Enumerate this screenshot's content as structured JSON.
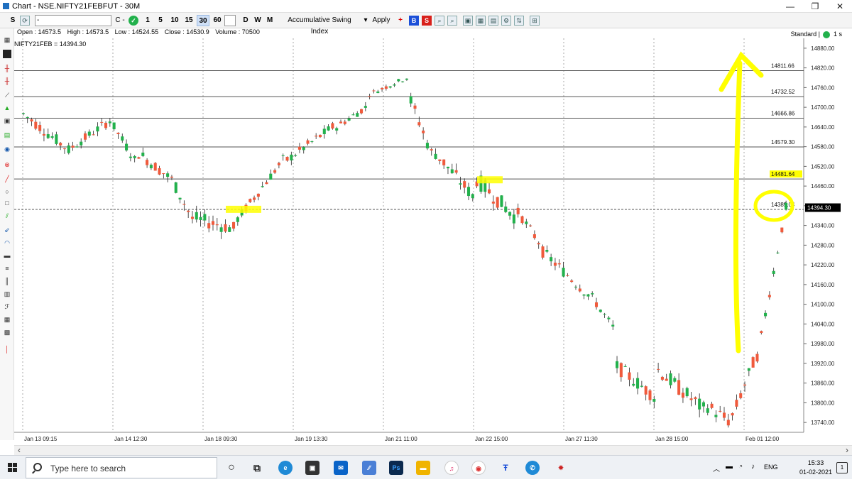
{
  "window": {
    "title": "Chart - NSE.NIFTY21FEBFUT - 30M",
    "minimize": "—",
    "maximize": "❐",
    "close": "✕"
  },
  "toolbar": {
    "s_label": "S",
    "symbol_input": "-",
    "chart_type": "C -",
    "intervals": [
      "1",
      "5",
      "10",
      "15",
      "30",
      "60"
    ],
    "selected_interval": "30",
    "periods": [
      "D",
      "W",
      "M"
    ],
    "indicator": "Accumulative Swing Index",
    "indicator_arrow": "▾",
    "apply_label": "Apply",
    "plus_label": "+",
    "buy_label": "B",
    "sell_label": "S"
  },
  "ohlc": {
    "open": "Open : 14573.5",
    "high": "High : 14573.5",
    "low": "Low : 14524.55",
    "close": "Close : 14530.9",
    "volume": "Volume : 70500"
  },
  "symbol_label": "NIFTY21FEB = 14394.30",
  "standard_label": "Standard |",
  "timeframe_label": "1 s",
  "colors": {
    "bull": "#22b14c",
    "bear": "#f05a3c",
    "highlight": "#ffff00",
    "price_label_bg": "#000000"
  },
  "chart_data": {
    "type": "candlestick",
    "instrument": "NIFTY21FEB",
    "last_price": 14394.3,
    "last_price_label": "14394.30",
    "y_ticks": [
      "14880.00",
      "14820.00",
      "14760.00",
      "14700.00",
      "14640.00",
      "14580.00",
      "14520.00",
      "14460.00",
      "14400.00",
      "14340.00",
      "14280.00",
      "14220.00",
      "14160.00",
      "14100.00",
      "14040.00",
      "13980.00",
      "13920.00",
      "13860.00",
      "13800.00",
      "13740.00"
    ],
    "y_tick_values": [
      14880,
      14820,
      14760,
      14700,
      14640,
      14580,
      14520,
      14460,
      14400,
      14340,
      14280,
      14220,
      14160,
      14100,
      14040,
      13980,
      13920,
      13860,
      13800,
      13740
    ],
    "ylim": [
      13710,
      14910
    ],
    "x_labels": [
      "Jan 13 09:15",
      "Jan 14 12:30",
      "Jan 18 09:30",
      "Jan 19 13:30",
      "Jan 21 11:00",
      "Jan 22 15:00",
      "Jan 27 11:30",
      "Jan 28 15:00",
      "Feb 01 12:00"
    ],
    "horizontal_lines": [
      {
        "value": 14811.66,
        "label": "14811.66",
        "highlight": false
      },
      {
        "value": 14732.52,
        "label": "14732.52",
        "highlight": false
      },
      {
        "value": 14666.86,
        "label": "14666.86",
        "highlight": false
      },
      {
        "value": 14579.3,
        "label": "14579.30",
        "highlight": false
      },
      {
        "value": 14481.64,
        "label": "14481.64",
        "highlight": true
      },
      {
        "value": 14389.04,
        "label": "14389.04",
        "highlight": false,
        "dashed": true
      }
    ],
    "segments": [
      {
        "n": 12,
        "start": 14680,
        "end": 14570,
        "noise": 18
      },
      {
        "n": 10,
        "start": 14580,
        "end": 14660,
        "noise": 15
      },
      {
        "n": 6,
        "start": 14640,
        "end": 14540,
        "noise": 15
      },
      {
        "n": 8,
        "start": 14560,
        "end": 14490,
        "noise": 18
      },
      {
        "n": 6,
        "start": 14480,
        "end": 14360,
        "noise": 20
      },
      {
        "n": 10,
        "start": 14360,
        "end": 14330,
        "noise": 22
      },
      {
        "n": 12,
        "start": 14360,
        "end": 14540,
        "noise": 15
      },
      {
        "n": 12,
        "start": 14540,
        "end": 14640,
        "noise": 15
      },
      {
        "n": 8,
        "start": 14640,
        "end": 14700,
        "noise": 12
      },
      {
        "n": 10,
        "start": 14740,
        "end": 14790,
        "noise": 8
      },
      {
        "n": 6,
        "start": 14720,
        "end": 14560,
        "noise": 22
      },
      {
        "n": 10,
        "start": 14560,
        "end": 14430,
        "noise": 22
      },
      {
        "n": 10,
        "start": 14480,
        "end": 14370,
        "noise": 25
      },
      {
        "n": 6,
        "start": 14380,
        "end": 14290,
        "noise": 15
      },
      {
        "n": 12,
        "start": 14260,
        "end": 14130,
        "noise": 18
      },
      {
        "n": 6,
        "start": 14120,
        "end": 14030,
        "noise": 15
      },
      {
        "n": 10,
        "start": 13910,
        "end": 13820,
        "noise": 22
      },
      {
        "n": 12,
        "start": 13900,
        "end": 13780,
        "noise": 25
      },
      {
        "n": 6,
        "start": 13790,
        "end": 13745,
        "noise": 22
      },
      {
        "n": 6,
        "start": 13760,
        "end": 13920,
        "noise": 20
      },
      {
        "n": 8,
        "start": 13940,
        "end": 14395,
        "noise": 15
      }
    ]
  }
}
